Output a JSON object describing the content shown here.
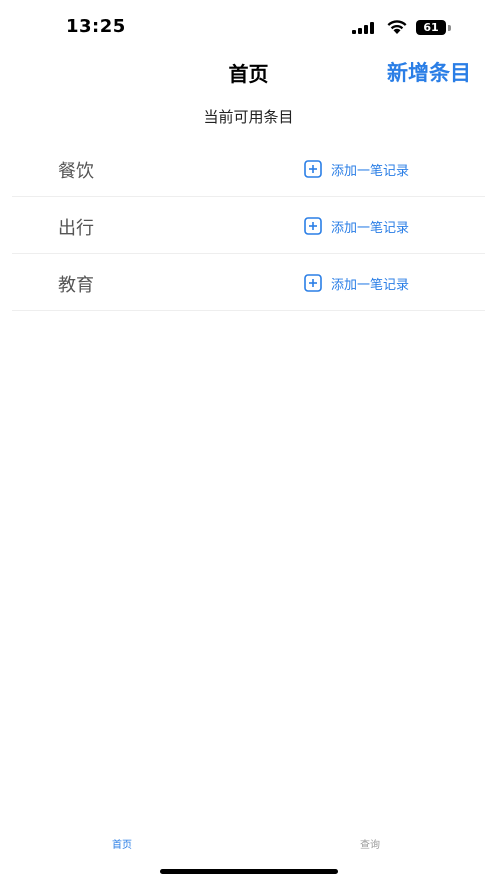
{
  "status_bar": {
    "time": "13:25",
    "battery": "61"
  },
  "nav": {
    "title": "首页",
    "action": "新增条目"
  },
  "section": {
    "header": "当前可用条目"
  },
  "items": [
    {
      "label": "餐饮",
      "add_label": "添加一笔记录"
    },
    {
      "label": "出行",
      "add_label": "添加一笔记录"
    },
    {
      "label": "教育",
      "add_label": "添加一笔记录"
    }
  ],
  "tab_bar": {
    "tabs": [
      {
        "label": "首页",
        "active": true
      },
      {
        "label": "查询",
        "active": false
      }
    ]
  },
  "colors": {
    "accent": "#2a7ee6",
    "inactive": "#9a9a9a"
  },
  "icons": {
    "add": "plus-square-icon",
    "signal": "cellular-signal-icon",
    "wifi": "wifi-icon",
    "battery": "battery-icon"
  }
}
